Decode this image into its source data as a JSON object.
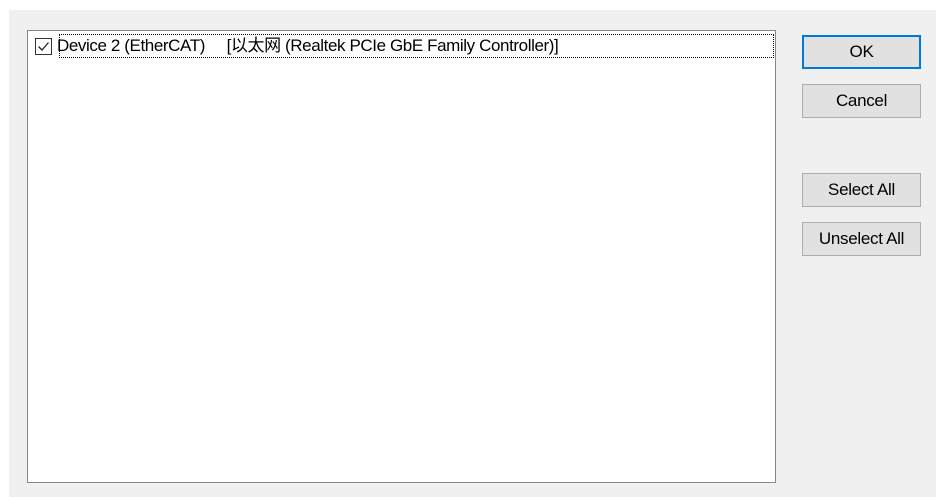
{
  "list": {
    "items": [
      {
        "checked": true,
        "label": "Device 2 (EtherCAT)     [以太网 (Realtek PCIe GbE Family Controller)]"
      }
    ]
  },
  "buttons": {
    "ok": "OK",
    "cancel": "Cancel",
    "select_all": "Select All",
    "unselect_all": "Unselect All"
  },
  "colors": {
    "window_bg": "#f0f0f0",
    "list_bg": "#ffffff",
    "button_face": "#e1e1e1",
    "default_button_border": "#0078d7"
  },
  "icons": {
    "checkbox_checked": "checkmark-icon"
  }
}
